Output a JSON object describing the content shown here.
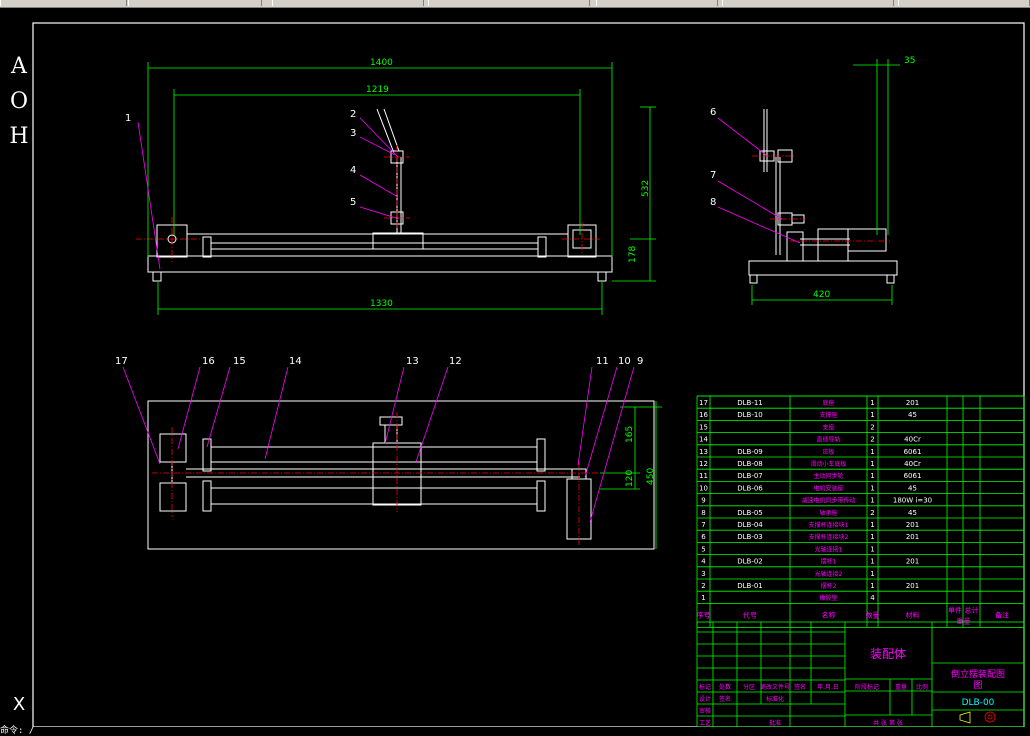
{
  "ucs_letters": [
    "A",
    "O",
    "H"
  ],
  "ucs_axis_glyph": "X",
  "command_prompt": "命令: /",
  "dims": {
    "front_overall": "1400",
    "front_inner": "1219",
    "front_height": "532",
    "front_base_h": "178",
    "front_base_len": "1330",
    "side_offset": "35",
    "side_width": "420",
    "top_165": "165",
    "top_120": "120",
    "top_450": "450"
  },
  "balloons_front": [
    "1",
    "2",
    "3",
    "4",
    "5"
  ],
  "balloons_side": [
    "6",
    "7",
    "8"
  ],
  "balloons_top": [
    "17",
    "16",
    "15",
    "14",
    "13",
    "12",
    "11",
    "10",
    "9"
  ],
  "bom": {
    "rows": [
      {
        "no": "17",
        "code": "DLB-11",
        "name": "底座",
        "qty": "1",
        "mat": "201",
        "w": "",
        "note": ""
      },
      {
        "no": "16",
        "code": "DLB-10",
        "name": "支撑座",
        "qty": "1",
        "mat": "45",
        "w": "",
        "note": ""
      },
      {
        "no": "15",
        "code": "",
        "name": "支座",
        "qty": "2",
        "mat": "",
        "w": "",
        "note": ""
      },
      {
        "no": "14",
        "code": "",
        "name": "直线导轨",
        "qty": "2",
        "mat": "40Cr",
        "w": "",
        "note": ""
      },
      {
        "no": "13",
        "code": "DLB-09",
        "name": "压板",
        "qty": "1",
        "mat": "6061",
        "w": "",
        "note": ""
      },
      {
        "no": "12",
        "code": "DLB-08",
        "name": "滑动小车底板",
        "qty": "1",
        "mat": "40Cr",
        "w": "",
        "note": ""
      },
      {
        "no": "11",
        "code": "DLB-07",
        "name": "主动同步轮",
        "qty": "1",
        "mat": "6061",
        "w": "",
        "note": ""
      },
      {
        "no": "10",
        "code": "DLB-06",
        "name": "电机安装座",
        "qty": "1",
        "mat": "45",
        "w": "",
        "note": ""
      },
      {
        "no": "9",
        "code": "",
        "name": "减速电机同步带传动",
        "qty": "1",
        "mat": "180W i=30",
        "w": "",
        "note": ""
      },
      {
        "no": "8",
        "code": "DLB-05",
        "name": "轴承座",
        "qty": "2",
        "mat": "45",
        "w": "",
        "note": ""
      },
      {
        "no": "7",
        "code": "DLB-04",
        "name": "支撑杆连接块1",
        "qty": "1",
        "mat": "201",
        "w": "",
        "note": ""
      },
      {
        "no": "6",
        "code": "DLB-03",
        "name": "支撑杆连接块2",
        "qty": "1",
        "mat": "201",
        "w": "",
        "note": ""
      },
      {
        "no": "5",
        "code": "",
        "name": "光轴连接1",
        "qty": "1",
        "mat": "",
        "w": "",
        "note": ""
      },
      {
        "no": "4",
        "code": "DLB-02",
        "name": "摆杆1",
        "qty": "1",
        "mat": "201",
        "w": "",
        "note": ""
      },
      {
        "no": "3",
        "code": "",
        "name": "光轴连接2",
        "qty": "1",
        "mat": "",
        "w": "",
        "note": ""
      },
      {
        "no": "2",
        "code": "DLB-01",
        "name": "摆杆2",
        "qty": "1",
        "mat": "201",
        "w": "",
        "note": ""
      },
      {
        "no": "1",
        "code": "",
        "name": "橡胶垫",
        "qty": "4",
        "mat": "",
        "w": "",
        "note": ""
      }
    ],
    "header": {
      "no": "序号",
      "code": "代号",
      "name": "名称",
      "qty": "数量",
      "mat": "材料",
      "w1": "单件",
      "w2": "总计",
      "w3": "重量",
      "note": "备注"
    }
  },
  "title_block": {
    "assembly": "装配体",
    "drawing_name": "倒立摆装配图",
    "drawing_name_line2": "图",
    "drawing_code": "DLB-00",
    "labels_row1": [
      "标记",
      "处数",
      "分区",
      "更改文件号",
      "签名",
      "年.月.日"
    ],
    "labels_row2": [
      "设计",
      "签名",
      "标准化"
    ],
    "labels_stage": [
      "阶段标记",
      "重量",
      "比例"
    ],
    "labels_row3": [
      "审核"
    ],
    "labels_row4": [
      "工艺",
      "批准"
    ],
    "footer": [
      "共 张 第 张"
    ]
  },
  "colors": {
    "border": "#ffffff",
    "geometry": "#ffffff",
    "dimension": "#00ff00",
    "balloon_text": "#ffffff",
    "leader": "#ff00ff",
    "centerline": "#ff0000",
    "table_grid": "#00ff00",
    "table_text": "#ff00ff",
    "title_text": "#ff00ff",
    "code_text": "#00ffff",
    "symbol": "#ffff00"
  }
}
